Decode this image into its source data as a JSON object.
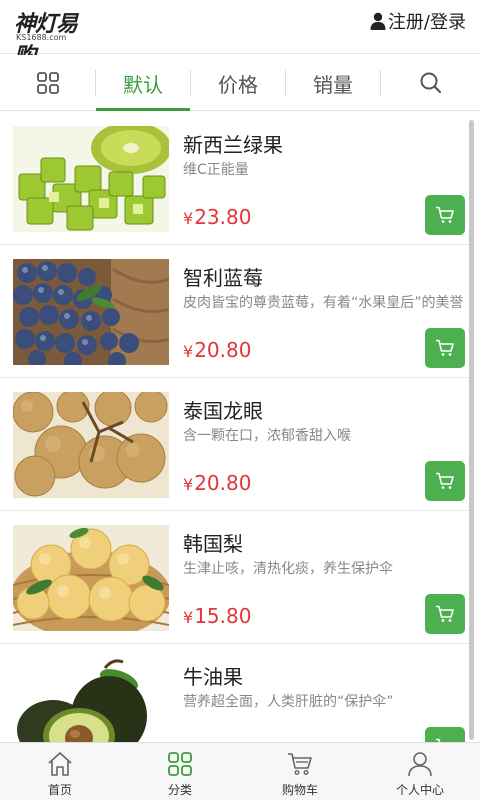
{
  "header": {
    "logo_text": "神灯易购",
    "logo_sub": "KS1688.com",
    "login_label": "注册/登录",
    "icon": "person-icon"
  },
  "filters": {
    "grid_icon": "grid-icon",
    "tabs": [
      "默认",
      "价格",
      "销量"
    ],
    "active_tab": "默认",
    "search_icon": "search-icon",
    "accent_color": "#3c9a3c"
  },
  "products": [
    {
      "name": "新西兰绿果",
      "desc": "维C正能量",
      "currency": "¥",
      "price": "23.80"
    },
    {
      "name": "智利蓝莓",
      "desc": "皮肉皆宝的尊贵蓝莓，有着“水果皇后”的美誉",
      "currency": "¥",
      "price": "20.80"
    },
    {
      "name": "泰国龙眼",
      "desc": "含一颗在口，浓郁香甜入喉",
      "currency": "¥",
      "price": "20.80"
    },
    {
      "name": "韩国梨",
      "desc": "生津止咳，清热化痰，养生保护伞",
      "currency": "¥",
      "price": "15.80"
    },
    {
      "name": "牛油果",
      "desc": "营养超全面，人类肝脏的“保护伞”",
      "currency": "¥",
      "price": ""
    }
  ],
  "colors": {
    "price": "#e2373a",
    "cart_button": "#4caf50"
  },
  "bottom_nav": [
    {
      "label": "首页",
      "icon": "home-icon"
    },
    {
      "label": "分类",
      "icon": "category-icon"
    },
    {
      "label": "购物车",
      "icon": "cart-icon"
    },
    {
      "label": "个人中心",
      "icon": "user-icon"
    }
  ],
  "bottom_nav_active": "分类"
}
